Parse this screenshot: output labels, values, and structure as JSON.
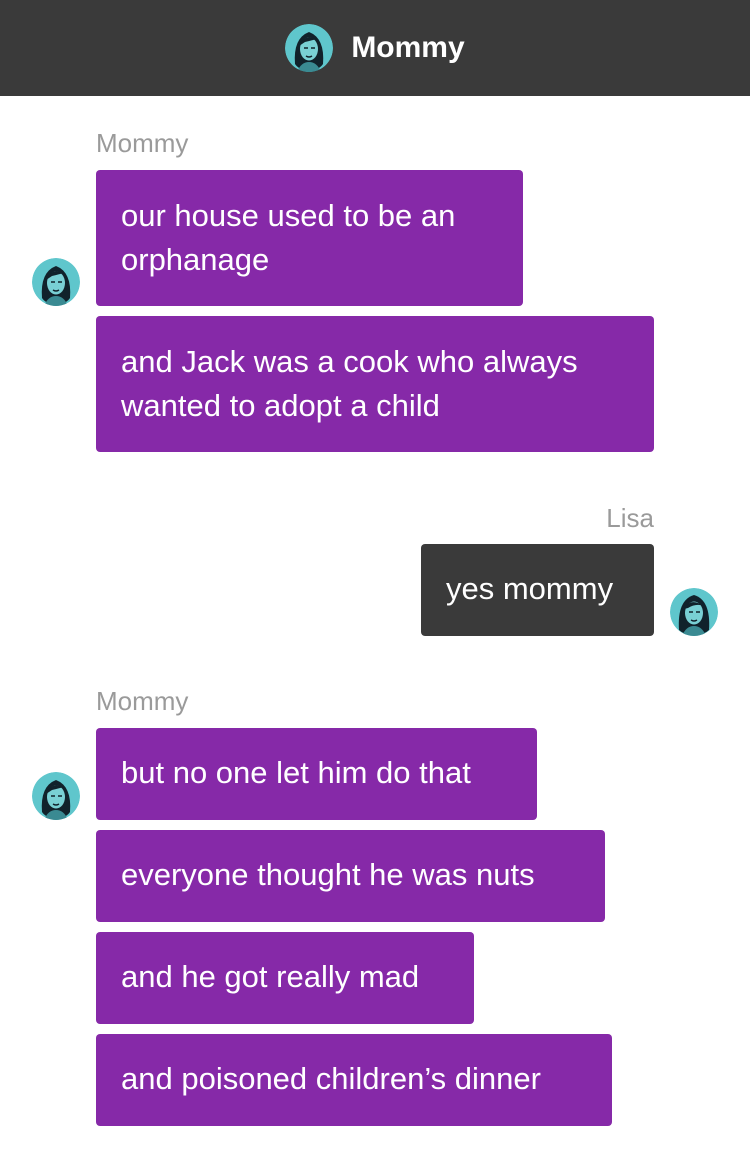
{
  "header": {
    "title": "Mommy",
    "avatar_icon": "woman-portrait-avatar-icon"
  },
  "colors": {
    "header_bg": "#3a3a3a",
    "incoming_bubble": "#8629a8",
    "outgoing_bubble": "#3a3a3a",
    "sender_label": "#9a9a9a",
    "avatar_bg": "#5fc6cc"
  },
  "messages": [
    {
      "sender": "Mommy",
      "direction": "incoming",
      "bubbles": [
        "our house used to be an\norphanage",
        "and Jack was a cook who always\nwanted to adopt a child"
      ]
    },
    {
      "sender": "Lisa",
      "direction": "outgoing",
      "bubbles": [
        "yes mommy"
      ]
    },
    {
      "sender": "Mommy",
      "direction": "incoming",
      "bubbles": [
        "but no one let him do that",
        "everyone thought he was nuts",
        "and he got really mad",
        "and poisoned children’s dinner"
      ]
    }
  ]
}
